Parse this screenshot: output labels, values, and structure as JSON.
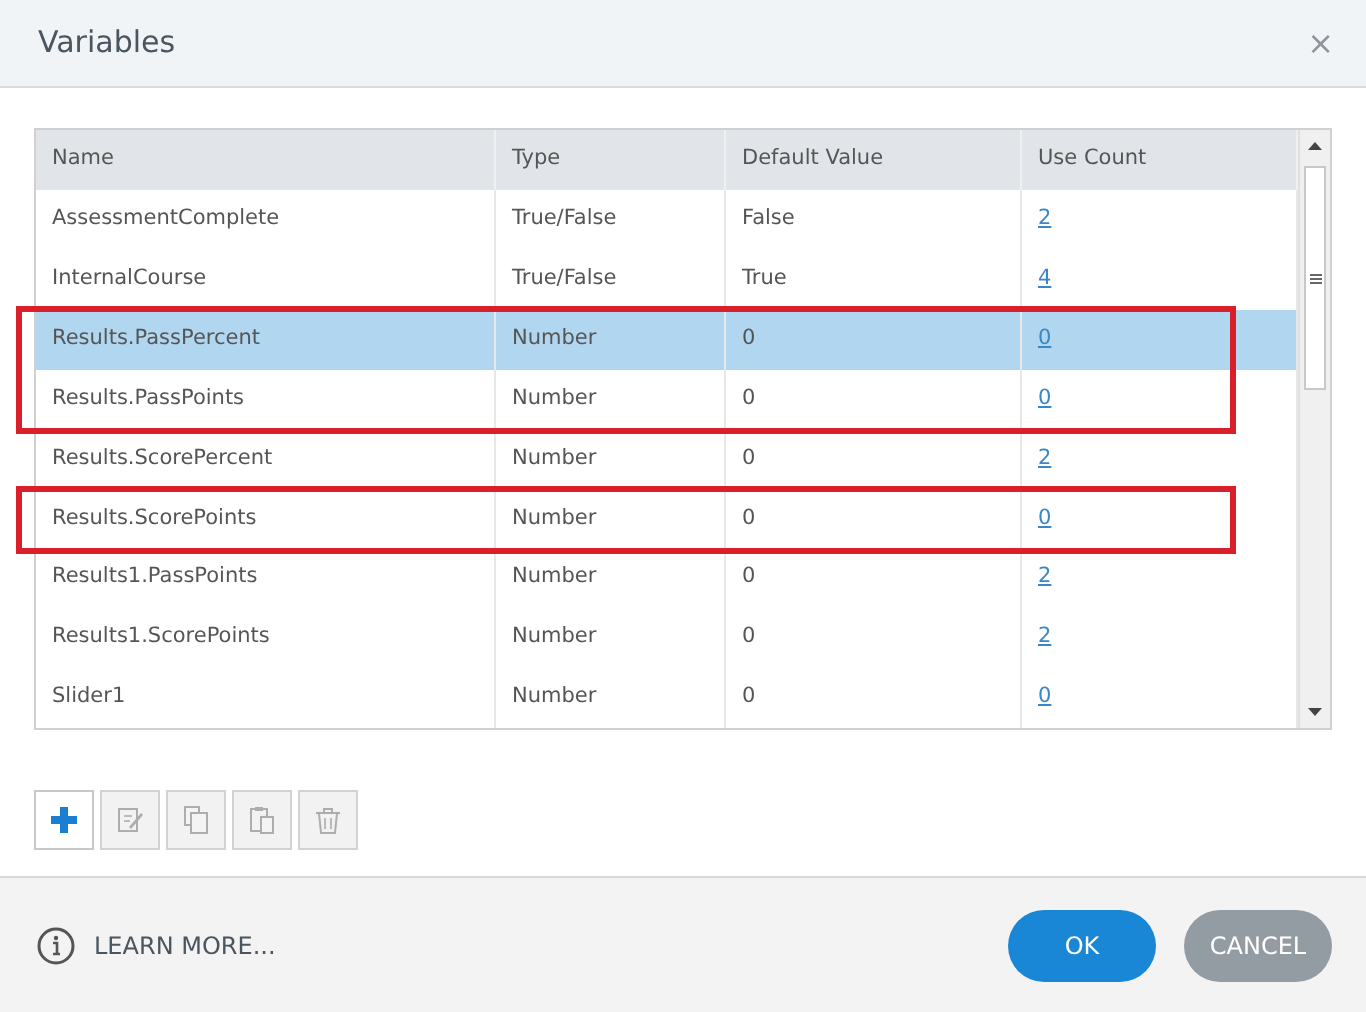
{
  "window": {
    "title": "Variables",
    "close": "×"
  },
  "table": {
    "columns": [
      "Name",
      "Type",
      "Default Value",
      "Use Count"
    ],
    "rows": [
      {
        "name": "AssessmentComplete",
        "type": "True/False",
        "default_value": "False",
        "use_count": "2",
        "selected": false,
        "outlined": false
      },
      {
        "name": "InternalCourse",
        "type": "True/False",
        "default_value": "True",
        "use_count": "4",
        "selected": false,
        "outlined": false
      },
      {
        "name": "Results.PassPercent",
        "type": "Number",
        "default_value": "0",
        "use_count": "0",
        "selected": true,
        "outlined": true
      },
      {
        "name": "Results.PassPoints",
        "type": "Number",
        "default_value": "0",
        "use_count": "0",
        "selected": false,
        "outlined": true
      },
      {
        "name": "Results.ScorePercent",
        "type": "Number",
        "default_value": "0",
        "use_count": "2",
        "selected": false,
        "outlined": false
      },
      {
        "name": "Results.ScorePoints",
        "type": "Number",
        "default_value": "0",
        "use_count": "0",
        "selected": false,
        "outlined": true
      },
      {
        "name": "Results1.PassPoints",
        "type": "Number",
        "default_value": "0",
        "use_count": "2",
        "selected": false,
        "outlined": false
      },
      {
        "name": "Results1.ScorePoints",
        "type": "Number",
        "default_value": "0",
        "use_count": "2",
        "selected": false,
        "outlined": false
      },
      {
        "name": "Slider1",
        "type": "Number",
        "default_value": "0",
        "use_count": "0",
        "selected": false,
        "outlined": false
      }
    ]
  },
  "toolbar": [
    {
      "kind": "add",
      "disabled": false
    },
    {
      "kind": "edit",
      "disabled": true
    },
    {
      "kind": "copy",
      "disabled": true
    },
    {
      "kind": "paste",
      "disabled": true
    },
    {
      "kind": "delete",
      "disabled": true
    }
  ],
  "footer": {
    "learn_more": "LEARN MORE...",
    "buttons": [
      {
        "label": "OK",
        "kind": "primary"
      },
      {
        "label": "CANCEL",
        "kind": "secondary"
      }
    ]
  }
}
